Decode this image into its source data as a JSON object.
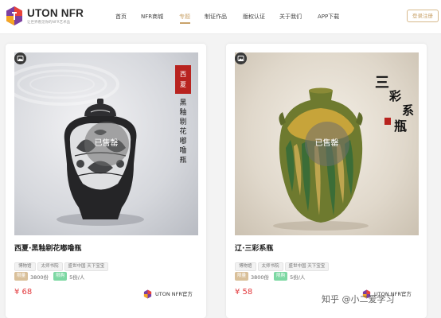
{
  "header": {
    "brand": "UTON NFR",
    "tagline": "让世界看见你的NFR艺术品",
    "nav": [
      {
        "label": "首页"
      },
      {
        "label": "NFR商城"
      },
      {
        "label": "专题"
      },
      {
        "label": "制证作品"
      },
      {
        "label": "版权认证"
      },
      {
        "label": "关于我们"
      },
      {
        "label": "APP下载"
      }
    ],
    "active_nav": "专题",
    "login_label": "登录注册"
  },
  "cards": [
    {
      "title": "西夏·黑釉剔花嘟噜瓶",
      "image_calligraphy": "西夏·黑釉剔花嘟噜瓶",
      "sold_label": "已售罄",
      "tags": [
        "博物馆",
        "太师书院",
        "盛世中国 天下宝宝"
      ],
      "limit_badge": "限量",
      "limit_value": "3800份",
      "buy_badge": "限购",
      "buy_value": "5份/人",
      "price": "¥ 68",
      "official": "UTON NFR官方"
    },
    {
      "title": "辽·三彩系瓶",
      "image_calligraphy": "三彩系瓶",
      "sold_label": "已售罄",
      "tags": [
        "博物馆",
        "太师书院",
        "盛世中国 天下宝宝"
      ],
      "limit_badge": "限量",
      "limit_value": "3800份",
      "buy_badge": "限购",
      "buy_value": "5份/人",
      "price": "¥ 58",
      "official": "UTON NFR官方"
    }
  ],
  "watermark": "知乎 @小二爱学习",
  "colors": {
    "accent": "#c9a36a",
    "price": "#e2373b",
    "limit_badge": "#d9c09a",
    "buy_badge": "#7dd8a3"
  }
}
